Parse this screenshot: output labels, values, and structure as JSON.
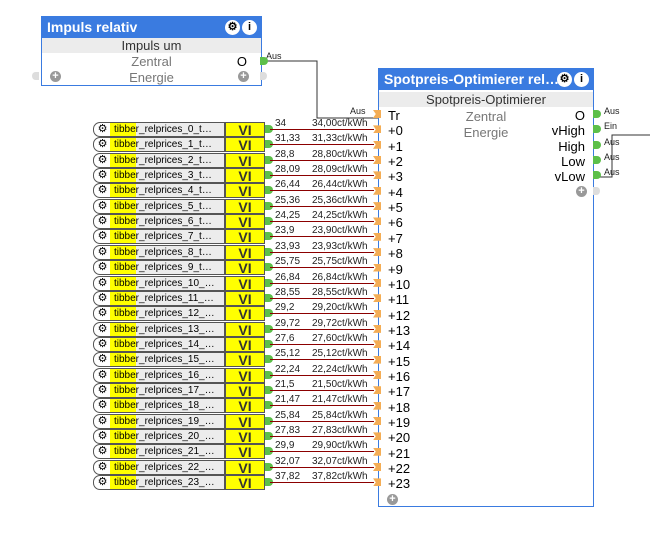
{
  "impuls": {
    "title": "Impuls relativ",
    "subtitle": "Impuls um",
    "inputs": [
      "Zentral",
      "Energie"
    ],
    "output": "O",
    "output_value": "Aus"
  },
  "optimizer": {
    "title": "Spotpreis-Optimierer rel…",
    "subtitle": "Spotpreis-Optimierer",
    "center_labels": [
      "Zentral",
      "Energie"
    ],
    "inputs": [
      "Tr",
      "+0",
      "+1",
      "+2",
      "+3",
      "+4",
      "+5",
      "+6",
      "+7",
      "+8",
      "+9",
      "+10",
      "+11",
      "+12",
      "+13",
      "+14",
      "+15",
      "+16",
      "+17",
      "+18",
      "+19",
      "+20",
      "+21",
      "+22",
      "+23"
    ],
    "tr_value": "Aus",
    "outputs": [
      {
        "label": "O",
        "value": "Aus"
      },
      {
        "label": "vHigh",
        "value": "Ein"
      },
      {
        "label": "High",
        "value": "Aus"
      },
      {
        "label": "Low",
        "value": "Aus"
      },
      {
        "label": "vLow",
        "value": "Aus"
      }
    ]
  },
  "vi_label": "VI",
  "prices": [
    {
      "name": "tibber_relprices_0_t…",
      "raw": "34",
      "fmt": "34,00ct/kWh"
    },
    {
      "name": "tibber_relprices_1_t…",
      "raw": "31,33",
      "fmt": "31,33ct/kWh"
    },
    {
      "name": "tibber_relprices_2_t…",
      "raw": "28,8",
      "fmt": "28,80ct/kWh"
    },
    {
      "name": "tibber_relprices_3_t…",
      "raw": "28,09",
      "fmt": "28,09ct/kWh"
    },
    {
      "name": "tibber_relprices_4_t…",
      "raw": "26,44",
      "fmt": "26,44ct/kWh"
    },
    {
      "name": "tibber_relprices_5_t…",
      "raw": "25,36",
      "fmt": "25,36ct/kWh"
    },
    {
      "name": "tibber_relprices_6_t…",
      "raw": "24,25",
      "fmt": "24,25ct/kWh"
    },
    {
      "name": "tibber_relprices_7_t…",
      "raw": "23,9",
      "fmt": "23,90ct/kWh"
    },
    {
      "name": "tibber_relprices_8_t…",
      "raw": "23,93",
      "fmt": "23,93ct/kWh"
    },
    {
      "name": "tibber_relprices_9_t…",
      "raw": "25,75",
      "fmt": "25,75ct/kWh"
    },
    {
      "name": "tibber_relprices_10_…",
      "raw": "26,84",
      "fmt": "26,84ct/kWh"
    },
    {
      "name": "tibber_relprices_11_…",
      "raw": "28,55",
      "fmt": "28,55ct/kWh"
    },
    {
      "name": "tibber_relprices_12_…",
      "raw": "29,2",
      "fmt": "29,20ct/kWh"
    },
    {
      "name": "tibber_relprices_13_…",
      "raw": "29,72",
      "fmt": "29,72ct/kWh"
    },
    {
      "name": "tibber_relprices_14_…",
      "raw": "27,6",
      "fmt": "27,60ct/kWh"
    },
    {
      "name": "tibber_relprices_15_…",
      "raw": "25,12",
      "fmt": "25,12ct/kWh"
    },
    {
      "name": "tibber_relprices_16_…",
      "raw": "22,24",
      "fmt": "22,24ct/kWh"
    },
    {
      "name": "tibber_relprices_17_…",
      "raw": "21,5",
      "fmt": "21,50ct/kWh"
    },
    {
      "name": "tibber_relprices_18_…",
      "raw": "21,47",
      "fmt": "21,47ct/kWh"
    },
    {
      "name": "tibber_relprices_19_…",
      "raw": "25,84",
      "fmt": "25,84ct/kWh"
    },
    {
      "name": "tibber_relprices_20_…",
      "raw": "27,83",
      "fmt": "27,83ct/kWh"
    },
    {
      "name": "tibber_relprices_21_…",
      "raw": "29,9",
      "fmt": "29,90ct/kWh"
    },
    {
      "name": "tibber_relprices_22_…",
      "raw": "32,07",
      "fmt": "32,07ct/kWh"
    },
    {
      "name": "tibber_relprices_23_…",
      "raw": "37,82",
      "fmt": "37,82ct/kWh"
    }
  ]
}
